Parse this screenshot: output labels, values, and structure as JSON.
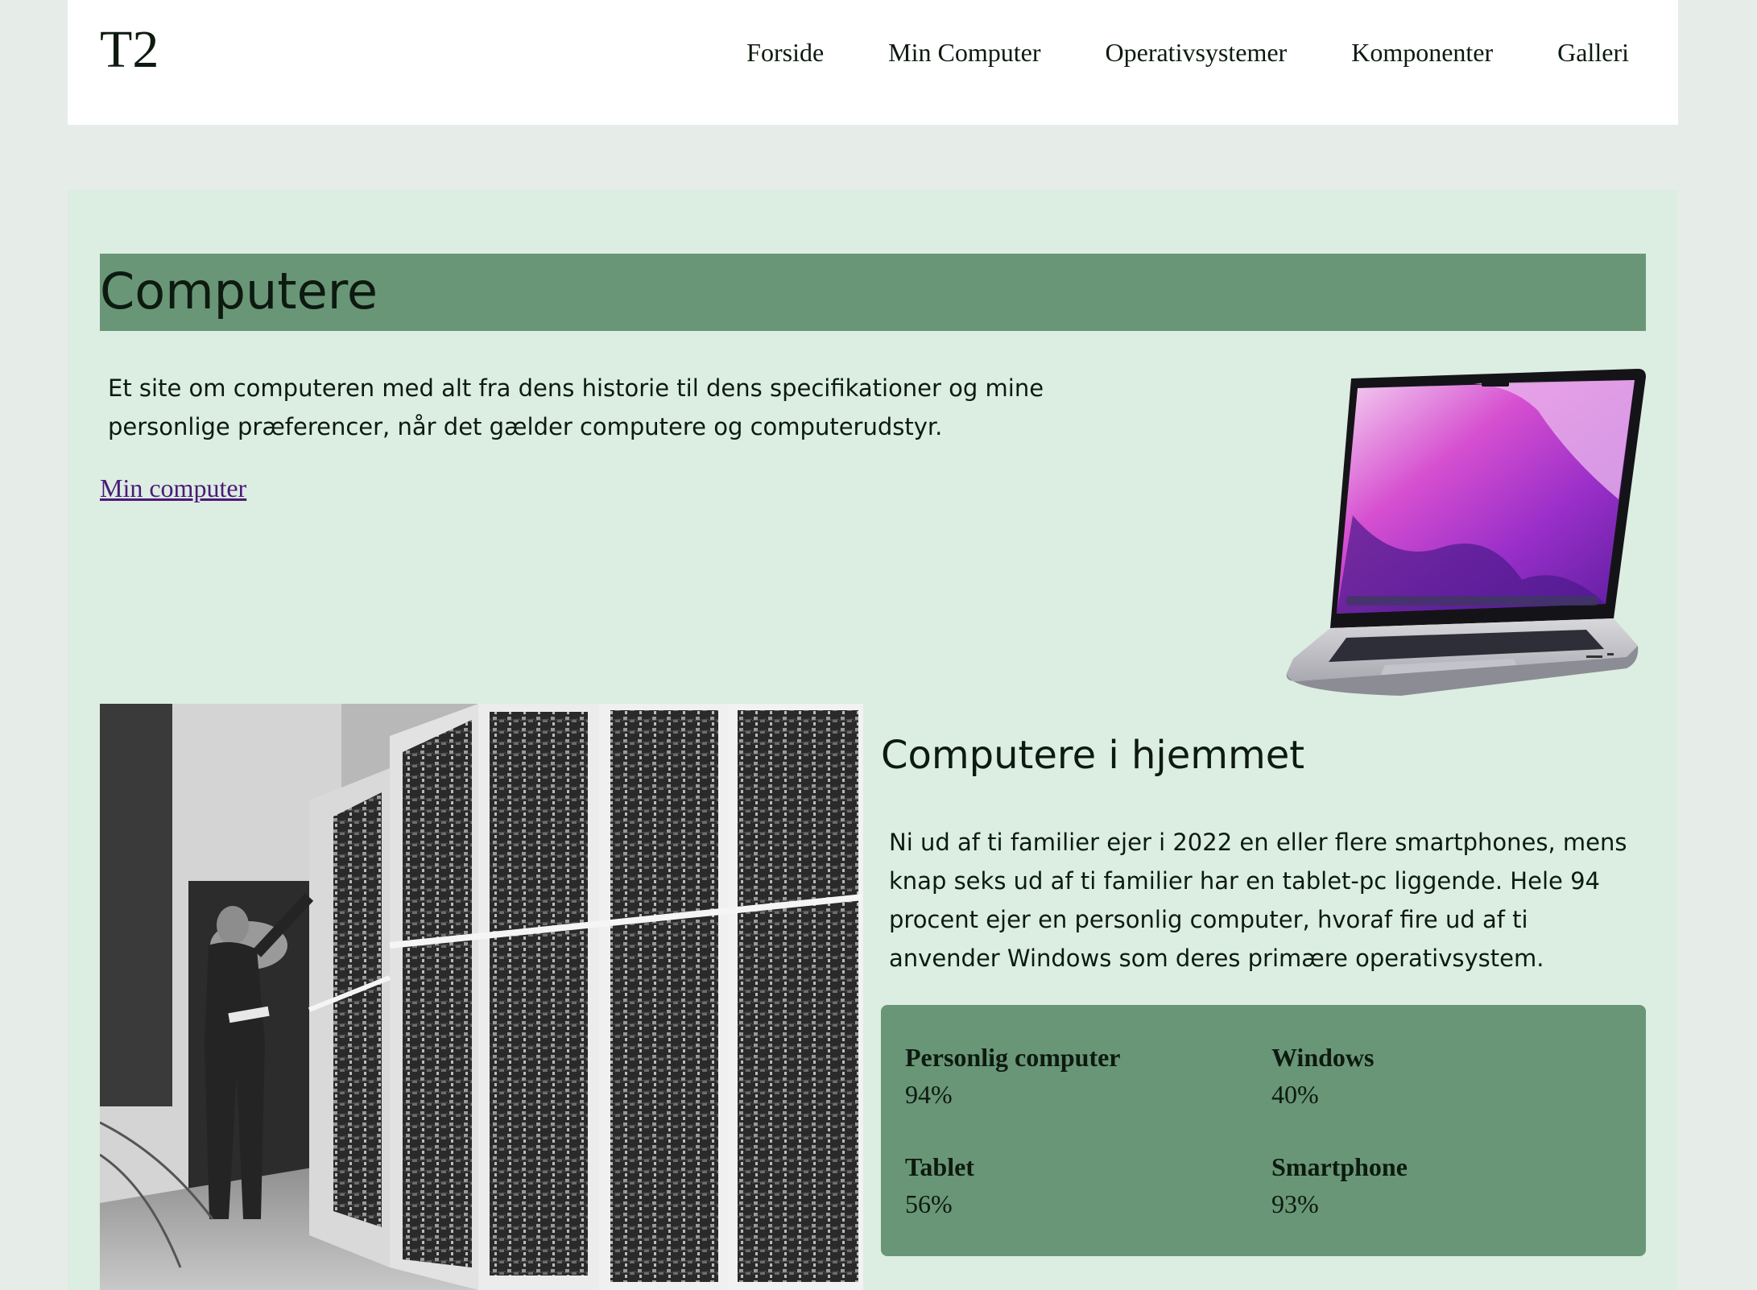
{
  "header": {
    "logo": "T2",
    "nav": [
      {
        "label": "Forside"
      },
      {
        "label": "Min Computer"
      },
      {
        "label": "Operativsystemer"
      },
      {
        "label": "Komponenter"
      },
      {
        "label": "Galleri"
      }
    ]
  },
  "hero": {
    "title": "Computere",
    "intro": "Et site om computeren med alt fra dens historie til dens specifikationer og mine personlige præferencer, når det gælder computere og computerudstyr.",
    "link_label": "Min computer"
  },
  "home_section": {
    "title": "Computere i hjemmet",
    "text": "Ni ud af ti familier ejer i 2022 en eller flere smartphones, mens knap seks ud af ti familier har en tablet-pc liggende. Hele 94 procent ejer en personlig computer, hvoraf fire ud af ti anvender Windows som deres primære operativsystem.",
    "stats": [
      {
        "label": "Personlig computer",
        "value": "94%"
      },
      {
        "label": "Windows",
        "value": "40%"
      },
      {
        "label": "Tablet",
        "value": "56%"
      },
      {
        "label": "Smartphone",
        "value": "93%"
      }
    ]
  },
  "colors": {
    "page_background": "#e6ede8",
    "main_background": "#dcede1",
    "accent_green": "#699677",
    "link_color": "#4b1a7a"
  }
}
